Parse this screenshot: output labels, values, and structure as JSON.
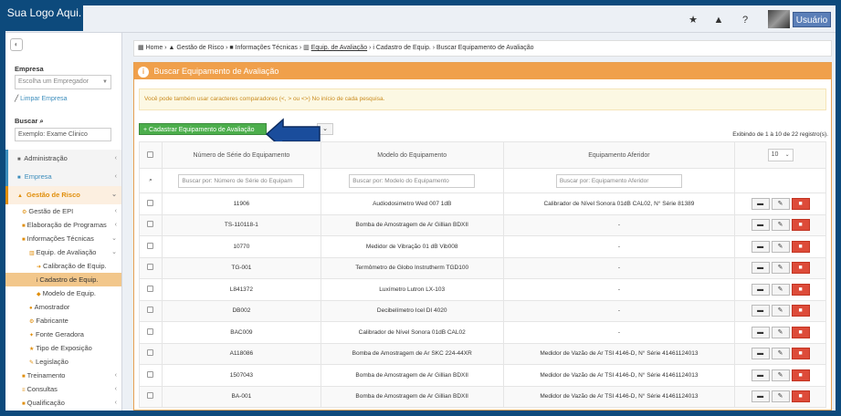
{
  "topbar": {
    "logo": "Sua Logo Aqui.",
    "icons": [
      "star-icon",
      "warning-icon",
      "help-icon"
    ],
    "user_label": "Usuário"
  },
  "sidebar": {
    "empresa_label": "Empresa",
    "empresa_placeholder": "Escolha um Empregador",
    "limpar_label": "Limpar Empresa",
    "buscar_label": "Buscar",
    "buscar_value": "Exemplo: Exame Clinico",
    "menu": {
      "administracao": "Administração",
      "empresa": "Empresa",
      "gestao_risco": "Gestão de Risco",
      "gestao_epi": "Gestão de EPI",
      "elaboracao": "Elaboração de Programas",
      "info_tecnicas": "Informações Técnicas",
      "equip_avaliacao": "Equip. de Avaliação",
      "calibracao": "Calibração de Equip.",
      "cadastro": "Cadastro de Equip.",
      "modelo": "Modelo de Equip.",
      "amostrador": "Amostrador",
      "fabricante": "Fabricante",
      "fonte": "Fonte Geradora",
      "tipo_exposicao": "Tipo de Exposição",
      "legislacao": "Legislação",
      "treinamento": "Treinamento",
      "consultas": "Consultas",
      "qualificacao": "Qualificação"
    }
  },
  "breadcrumb": {
    "home": "Home",
    "gestao": "Gestão de Risco",
    "info": "Informações Técnicas",
    "equip": "Equip. de Avaliação",
    "cadastro": "Cadastro de Equip.",
    "current": "Buscar Equipamento de Avaliação"
  },
  "panel": {
    "title": "Buscar Equipamento de Avaliação",
    "alert": "Você pode também usar caracteres comparadores (<, > ou <>) No início de cada pesquisa.",
    "add_button": "Cadastrar Equipamento de Avaliação",
    "records": "Exibindo de 1 à 10 de 22 registro(s).",
    "page_size": "10"
  },
  "table": {
    "headers": [
      "Número de Série do Equipamento",
      "Modelo do Equipamento",
      "Equipamento Aferidor"
    ],
    "filters": [
      "Buscar por: Número de Série do Equipam",
      "Buscar por: Modelo do Equipamento",
      "Buscar por: Equipamento Aferidor"
    ],
    "rows": [
      {
        "serie": "11906",
        "modelo": "Audiodosimetro Wed 007 1dB",
        "aferidor": "Calibrador de Nível Sonora 01dB CAL02, N° Série 81389"
      },
      {
        "serie": "TS-110118-1",
        "modelo": "Bomba de Amostragem de Ar Gillian BDXII",
        "aferidor": "-"
      },
      {
        "serie": "10770",
        "modelo": "Medidor de Vibração 01 dB Vib008",
        "aferidor": "-"
      },
      {
        "serie": "TG-001",
        "modelo": "Termômetro de Globo Instrutherm TGD100",
        "aferidor": "-"
      },
      {
        "serie": "L841372",
        "modelo": "Luxímetro Lutron LX-103",
        "aferidor": "-"
      },
      {
        "serie": "DB002",
        "modelo": "Decibelímetro Icel DI 4020",
        "aferidor": "-"
      },
      {
        "serie": "BAC009",
        "modelo": "Calibrador de Nível Sonora 01dB CAL02",
        "aferidor": "-"
      },
      {
        "serie": "A118086",
        "modelo": "Bomba de Amostragem de Ar SKC 224-44XR",
        "aferidor": "Medidor de Vazão de Ar TSI 4146-D, N° Série 41461124013"
      },
      {
        "serie": "1507043",
        "modelo": "Bomba de Amostragem de Ar Gillian BDXII",
        "aferidor": "Medidor de Vazão de Ar TSI 4146-D, N° Série 41461124013"
      },
      {
        "serie": "BA-001",
        "modelo": "Bomba de Amostragem de Ar Gillian BDXII",
        "aferidor": "Medidor de Vazão de Ar TSI 4146-D, N° Série 41461124013"
      }
    ]
  }
}
